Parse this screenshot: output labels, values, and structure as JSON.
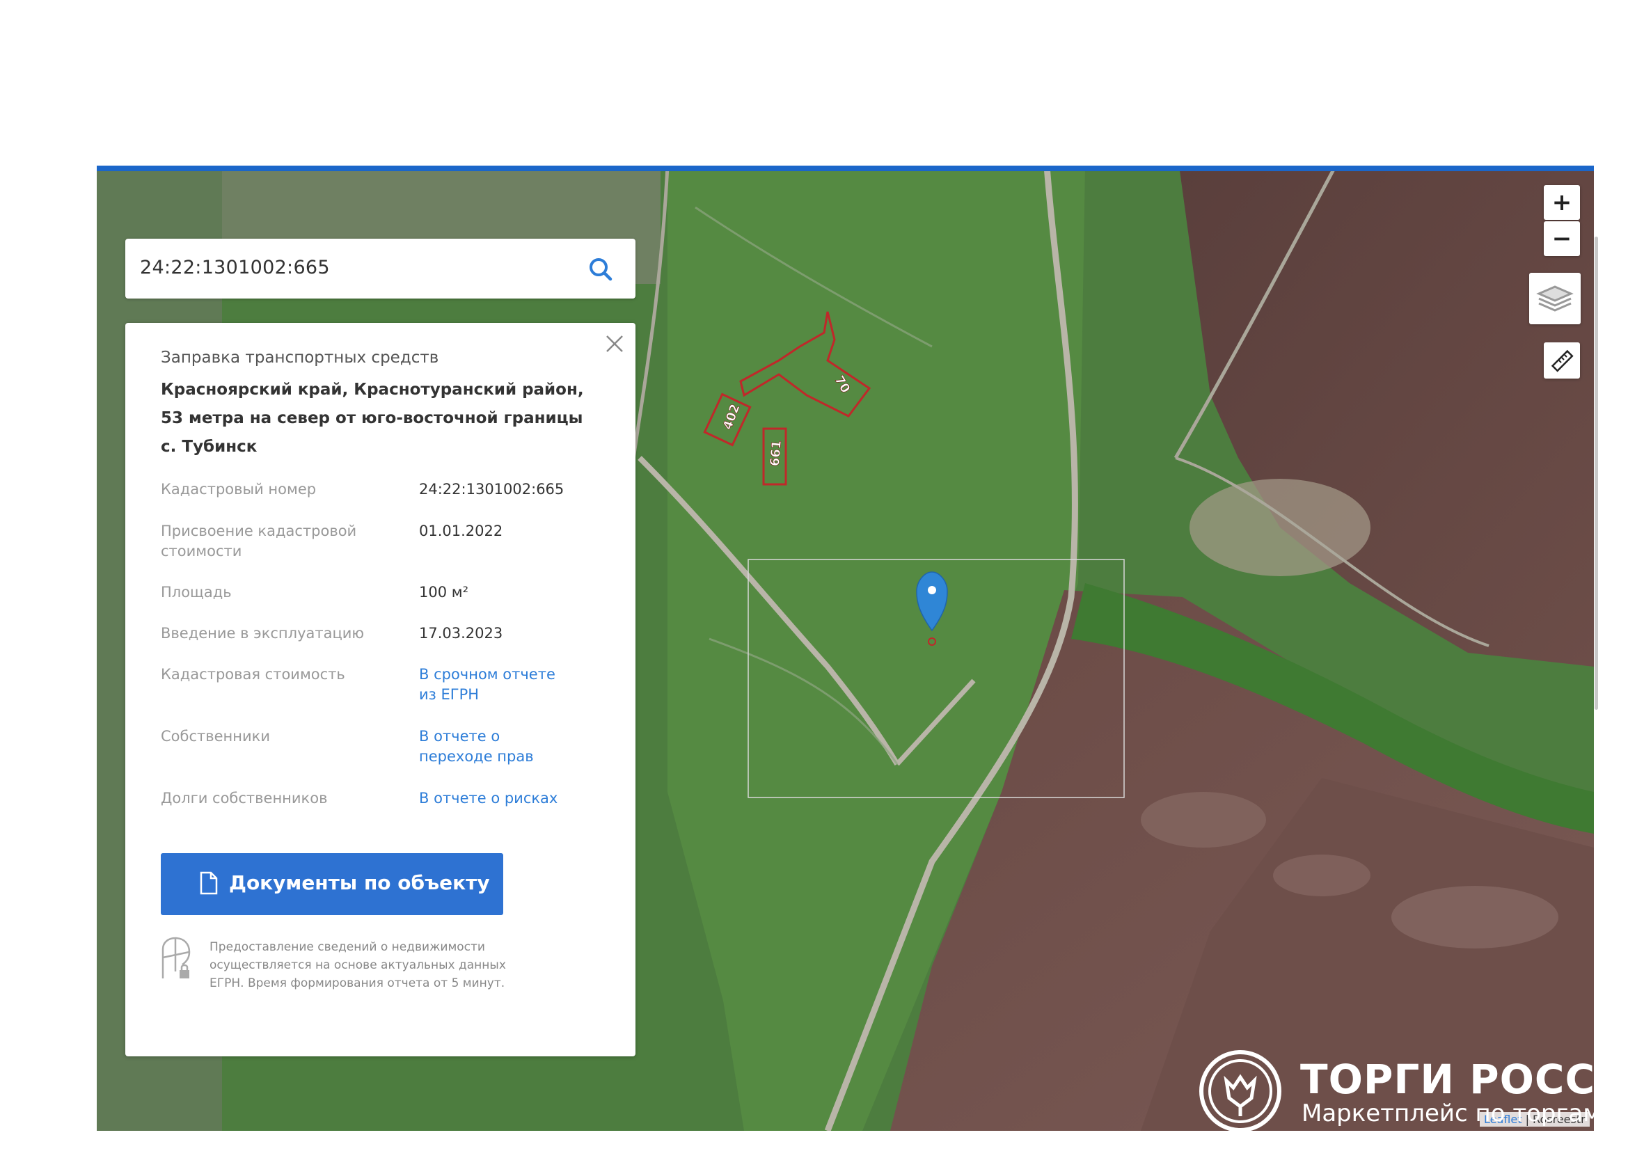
{
  "search": {
    "value": "24:22:1301002:665"
  },
  "panel": {
    "category": "Заправка транспортных средств",
    "address": "Красноярский край, Краснотуранский район, 53 метра на север от юго-восточной границы с. Тубинск",
    "rows": [
      {
        "label": "Кадастровый номер",
        "value": "24:22:1301002:665",
        "link": false
      },
      {
        "label": "Присвоение кадастровой стоимости",
        "value": "01.01.2022",
        "link": false
      },
      {
        "label": "Площадь",
        "value": "100 м²",
        "link": false
      },
      {
        "label": "Введение в эксплуатацию",
        "value": "17.03.2023",
        "link": false
      },
      {
        "label": "Кадастровая стоимость",
        "value": "В срочном отчете из ЕГРН",
        "link": true
      },
      {
        "label": "Собственники",
        "value": "В отчете о переходе прав",
        "link": true
      },
      {
        "label": "Долги собственников",
        "value": "В отчете о рисках",
        "link": true
      }
    ],
    "documents_button": "Документы по объекту",
    "notice": "Предоставление сведений о недвижимости осуществляется на основе актуальных данных ЕГРН. Время формирования отчета от 5 минут."
  },
  "map": {
    "parcel_labels": [
      "402",
      "661",
      "70"
    ],
    "zoom_in": "+",
    "zoom_out": "−",
    "attribution": {
      "leaflet": "Leaflet",
      "source": "Rosreestr"
    }
  },
  "watermark": {
    "title": "ТОРГИ РОССИИ",
    "subtitle": "Маркетплейс по торгам в России"
  },
  "colors": {
    "accent": "#2e72d2",
    "link": "#2d7dd8",
    "parcel_outline": "#c0282a",
    "marker": "#2f86d6"
  }
}
